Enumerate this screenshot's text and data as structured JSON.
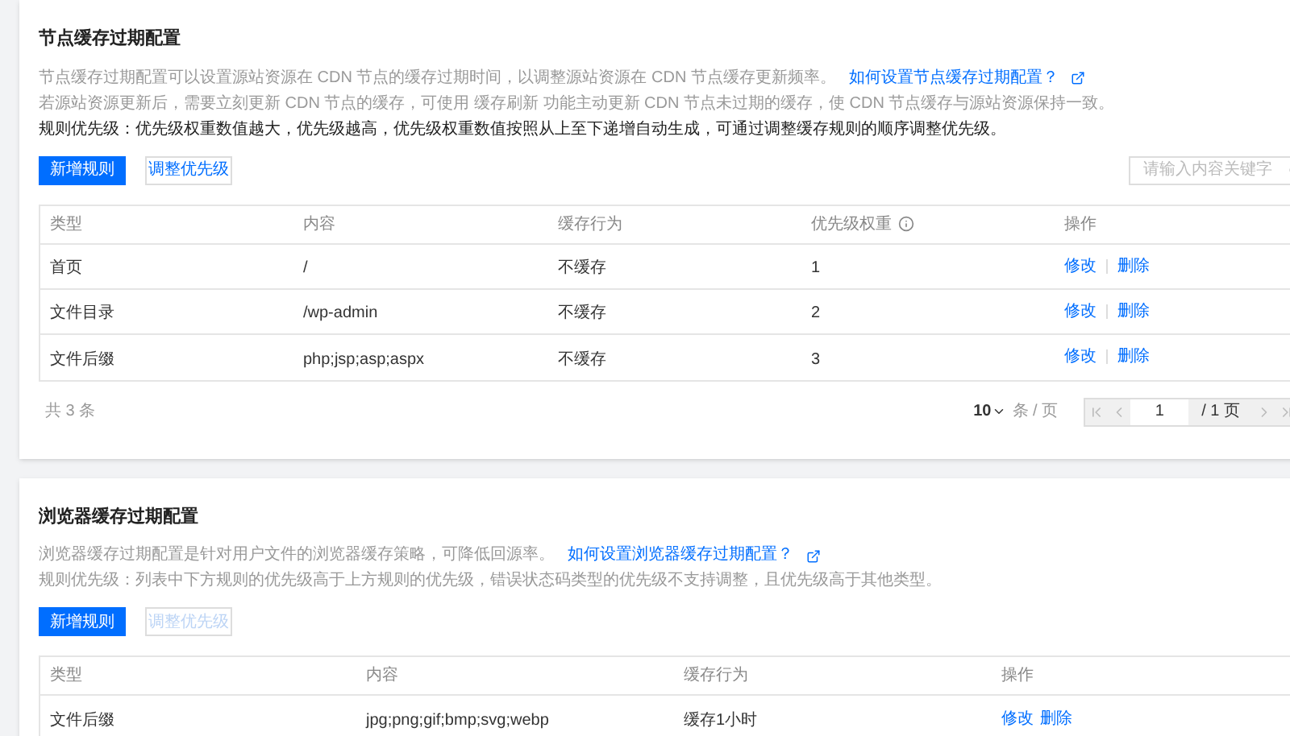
{
  "sections": [
    {
      "title": "节点缓存过期配置",
      "lines": [
        {
          "kind": "muted",
          "text": "节点缓存过期配置可以设置源站资源在 CDN 节点的缓存过期时间，以调整源站资源在 CDN 节点缓存更新频率。",
          "link": "如何设置节点缓存过期配置？"
        },
        {
          "kind": "muted",
          "text": "若源站资源更新后，需要立刻更新 CDN 节点的缓存，可使用 缓存刷新 功能主动更新 CDN 节点未过期的缓存，使 CDN 节点缓存与源站资源保持一致。"
        },
        {
          "kind": "strong",
          "text": "规则优先级：优先级权重数值越大，优先级越高，优先级权重数值按照从上至下递增自动生成，可通过调整缓存规则的顺序调整优先级。"
        }
      ],
      "buttons": [
        {
          "label": "新增规则",
          "kind": "primary",
          "disabled": false
        },
        {
          "label": "调整优先级",
          "kind": "default",
          "disabled": false
        }
      ],
      "search": {
        "placeholder": "请输入内容关键字"
      },
      "table": {
        "separated": true,
        "columns": [
          {
            "label": "类型",
            "info": false
          },
          {
            "label": "内容",
            "info": false
          },
          {
            "label": "缓存行为",
            "info": false
          },
          {
            "label": "优先级权重",
            "info": true
          },
          {
            "label": "操作",
            "info": false
          }
        ],
        "rows": [
          {
            "cells": [
              "首页",
              "/",
              "不缓存",
              "1"
            ],
            "actions": [
              "修改",
              "删除"
            ]
          },
          {
            "cells": [
              "文件目录",
              "/wp-admin",
              "不缓存",
              "2"
            ],
            "actions": [
              "修改",
              "删除"
            ]
          },
          {
            "cells": [
              "文件后缀",
              "php;jsp;asp;aspx",
              "不缓存",
              "3"
            ],
            "actions": [
              "修改",
              "删除"
            ]
          }
        ]
      },
      "footer": {
        "total": "共 3 条",
        "page_size": "10",
        "per_page": "条 / 页",
        "page": "1",
        "total_pages": "/ 1 页"
      }
    },
    {
      "title": "浏览器缓存过期配置",
      "lines": [
        {
          "kind": "muted",
          "text": "浏览器缓存过期配置是针对用户文件的浏览器缓存策略，可降低回源率。",
          "link": "如何设置浏览器缓存过期配置？"
        },
        {
          "kind": "muted",
          "text": "规则优先级：列表中下方规则的优先级高于上方规则的优先级，错误状态码类型的优先级不支持调整，且优先级高于其他类型。"
        }
      ],
      "buttons": [
        {
          "label": "新增规则",
          "kind": "primary",
          "disabled": false
        },
        {
          "label": "调整优先级",
          "kind": "default",
          "disabled": true
        }
      ],
      "table": {
        "separated": false,
        "columns": [
          {
            "label": "类型",
            "info": false
          },
          {
            "label": "内容",
            "info": false
          },
          {
            "label": "缓存行为",
            "info": false
          },
          {
            "label": "操作",
            "info": false
          }
        ],
        "rows": [
          {
            "cells": [
              "文件后缀",
              "jpg;png;gif;bmp;svg;webp",
              "缓存1小时"
            ],
            "actions": [
              "修改",
              "删除"
            ]
          }
        ]
      }
    }
  ]
}
